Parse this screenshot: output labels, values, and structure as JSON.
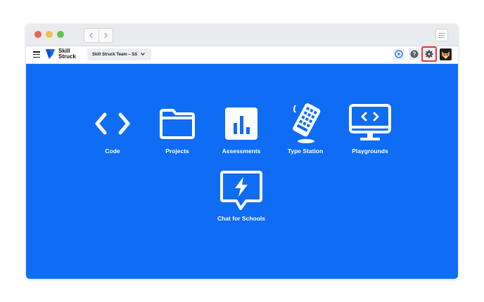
{
  "browser": {
    "back_icon": "chevron-left-icon",
    "forward_icon": "chevron-right-icon",
    "menu_icon": "menu-lines-icon"
  },
  "appbar": {
    "logo_line1": "Skill",
    "logo_line2": "Struck",
    "team_selector": "Skill Struck Team – SS",
    "icons": [
      "hamburger-icon",
      "play-circle-icon",
      "help-icon",
      "gear-icon",
      "fox-avatar"
    ]
  },
  "colors": {
    "brand_blue": "#0f6cf5",
    "highlight_red": "#e8392b"
  },
  "tiles": [
    {
      "label": "Code",
      "icon": "code-brackets-icon"
    },
    {
      "label": "Projects",
      "icon": "folder-icon"
    },
    {
      "label": "Assessments",
      "icon": "bar-chart-icon"
    },
    {
      "label": "Type Station",
      "icon": "keyboard-icon"
    },
    {
      "label": "Playgrounds",
      "icon": "monitor-code-icon"
    },
    {
      "label": "Chat for Schools",
      "icon": "chat-lightning-icon"
    }
  ]
}
